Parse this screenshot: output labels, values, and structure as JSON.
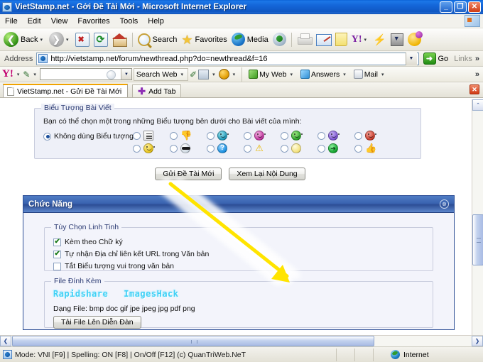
{
  "window": {
    "title": "VietStamp.net - Gởi Đề Tài Mới - Microsoft Internet Explorer",
    "minimize": "_",
    "maximize": "❐",
    "close": "✕"
  },
  "menu": {
    "items": [
      "File",
      "Edit",
      "View",
      "Favorites",
      "Tools",
      "Help"
    ]
  },
  "toolbar": {
    "back_label": "Back",
    "back_icon": "back-arrow-icon",
    "forward_icon": "forward-arrow-icon",
    "stop_icon": "stop-icon",
    "refresh_icon": "refresh-icon",
    "home_icon": "home-icon",
    "search_label": "Search",
    "search_icon": "magnifier-icon",
    "favorites_label": "Favorites",
    "favorites_icon": "star-icon",
    "media_label": "Media",
    "media_icon": "media-globe-icon",
    "history_icon": "history-icon",
    "print_icon": "printer-icon",
    "edit_icon": "edit-page-icon",
    "notes_icon": "notepad-icon",
    "yahoo_icon": "yahoo-bang-icon",
    "messenger_icon": "messenger-bolt-icon",
    "download_icon": "download-manager-icon",
    "yahoo_smiley_icon": "yahoo-smiley-icon",
    "caret": "▾"
  },
  "address": {
    "label": "Address",
    "url": "http://vietstamp.net/forum/newthread.php?do=newthread&f=16",
    "favicon": "page-favicon-icon",
    "dropdown_icon": "chevron-down-icon",
    "go_label": "Go",
    "go_icon": "go-arrow-icon",
    "links_label": "Links",
    "overflow_icon": "»"
  },
  "yahoo_toolbar": {
    "logo": "Y!",
    "logo_caret": "▾",
    "pen_icon": "pencil-icon",
    "search_value": "",
    "search_placeholder": "",
    "search_web_label": "Search Web",
    "highlight_icon": "highlighter-icon",
    "popup_icon": "popup-blocker-icon",
    "antispy_icon": "anti-spy-icon",
    "my_web_label": "My Web",
    "answers_label": "Answers",
    "mail_label": "Mail",
    "overflow_icon": "»",
    "caret": "▾"
  },
  "tabs": {
    "active_tab": "VietStamp.net - Gửi Đề Tài Mới",
    "add_tab_label": "Add Tab",
    "add_tab_icon": "plus-icon",
    "close_icon": "✕",
    "page_icon": "page-icon"
  },
  "page": {
    "icon_fieldset": {
      "legend": "Biểu Tượng Bài Viết",
      "description": "Bạn có thể chọn một trong những Biểu tượng bên dưới cho Bài viết của mình:",
      "no_icon_label": "Không dùng Biểu tượng",
      "no_icon_selected": true,
      "icons_row1": [
        {
          "name": "list-note-icon",
          "cls": "e-list"
        },
        {
          "name": "thumbs-down-icon",
          "cls": "e-thumbdown",
          "glyph": "👎"
        },
        {
          "name": "teal-smiley-icon",
          "cls": "e-teal emo-face"
        },
        {
          "name": "pink-smiley-icon",
          "cls": "e-pink emo-face"
        },
        {
          "name": "green-smiley-icon",
          "cls": "e-green emo-face"
        },
        {
          "name": "purple-smiley-icon",
          "cls": "e-purple emo-face"
        },
        {
          "name": "red-angry-icon",
          "cls": "e-red emo-face"
        }
      ],
      "icons_row2": [
        {
          "name": "yellow-smiley-icon",
          "cls": "e-yellow emo-face"
        },
        {
          "name": "sunglasses-smiley-icon",
          "cls": "e-shade"
        },
        {
          "name": "question-icon",
          "cls": "e-blueq"
        },
        {
          "name": "warning-icon",
          "cls": "e-warn",
          "glyph": "⚠"
        },
        {
          "name": "lightbulb-icon",
          "cls": "e-bulb"
        },
        {
          "name": "green-arrow-icon",
          "cls": "e-arrowg"
        },
        {
          "name": "thumbs-up-icon",
          "cls": "e-thumbup",
          "glyph": "👍"
        }
      ]
    },
    "buttons": {
      "submit": "Gửi Đề Tài Mới",
      "preview": "Xem Lại Nội Dung"
    },
    "panel": {
      "title": "Chức Năng",
      "collapse_icon": "collapse-icon",
      "options": {
        "legend": "Tùy Chọn Linh Tinh",
        "items": [
          {
            "label": "Kèm theo Chữ ký",
            "checked": true,
            "name": "signature"
          },
          {
            "label": "Tự nhận Địa chỉ liên kết URL trong Văn bản",
            "checked": true,
            "name": "autolink"
          },
          {
            "label": "Tắt Biểu tượng vui trong văn bản",
            "checked": false,
            "name": "disable-smilies"
          }
        ]
      },
      "attachments": {
        "legend": "File Đính Kèm",
        "host_links": [
          "Rapidshare",
          "ImagesHack"
        ],
        "file_types": "Dạng File: bmp doc gif jpe jpeg jpg pdf png",
        "upload_button": "Tải File Lên Diễn Đàn"
      }
    }
  },
  "scrollbars": {
    "up_icon": "⌃",
    "down_icon": "⌄",
    "left_icon": "❮",
    "right_icon": "❯"
  },
  "statusbar": {
    "text": "Mode: VNI [F9] | Spelling: ON [F8] | On/Off [F12] (c) QuanTriWeb.NeT",
    "zone": "Internet",
    "zone_icon": "internet-zone-icon",
    "page_icon": "page-icon"
  },
  "colors": {
    "titlebar_blue": "#1466d8",
    "panel_blue": "#2d4e96",
    "accent_cyan": "#3fd0f5",
    "arrow_yellow": "#ffe400"
  }
}
